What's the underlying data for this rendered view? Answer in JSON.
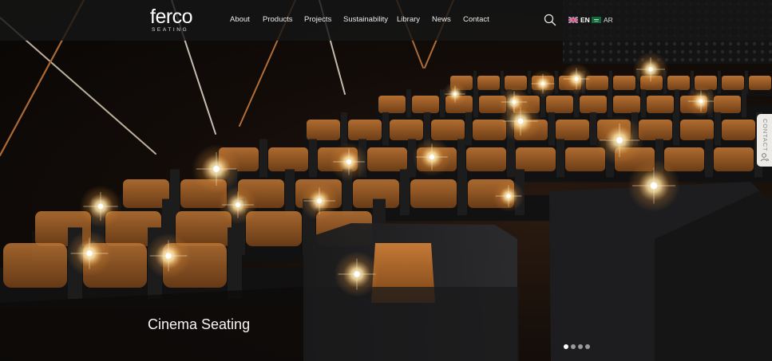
{
  "brand": {
    "name": "ferco",
    "tagline": "SEATING"
  },
  "nav": {
    "items": [
      {
        "label": "About",
        "name": "nav-about"
      },
      {
        "label": "Products",
        "name": "nav-products"
      },
      {
        "label": "Projects",
        "name": "nav-projects"
      },
      {
        "label": "Sustainability",
        "name": "nav-sustainability"
      },
      {
        "label": "Library",
        "name": "nav-library"
      },
      {
        "label": "News",
        "name": "nav-news"
      },
      {
        "label": "Contact",
        "name": "nav-contact"
      }
    ]
  },
  "header": {
    "search_icon": "search-icon",
    "languages": [
      {
        "code": "EN",
        "flag": "uk-flag-icon",
        "active": true
      },
      {
        "code": "AR",
        "flag": "saudi-flag-icon",
        "active": false
      }
    ]
  },
  "side_tab": {
    "label": "CONTACT",
    "icon": "contact-person-icon"
  },
  "hero": {
    "caption": "Cinema Seating",
    "slides_total": 4,
    "slide_active": 1
  },
  "colors": {
    "topbar": "#161616",
    "seat_leather": "#b06a2c",
    "light_glow": "#ffe7b0",
    "text": "#ffffff"
  }
}
